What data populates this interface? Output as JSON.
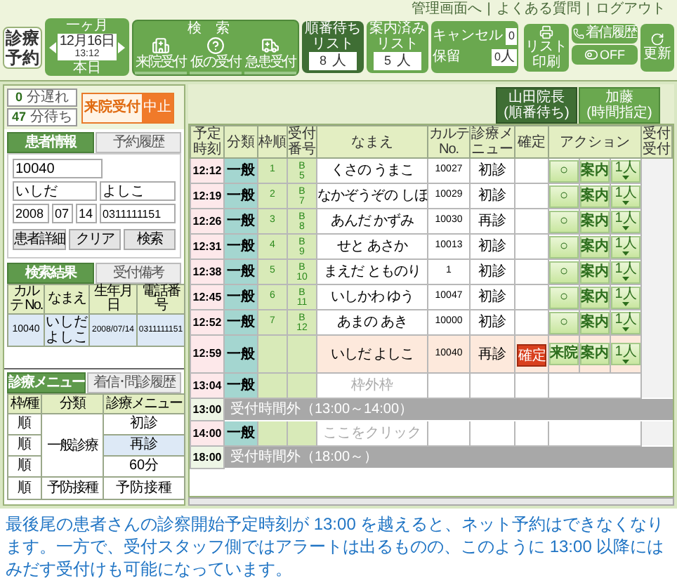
{
  "header": {
    "logo": [
      "診療",
      "予約"
    ],
    "date": {
      "range": "一ヶ月",
      "date": "12月16日",
      "time": "13:12",
      "today": "本日"
    },
    "search_label": "検索",
    "actions": [
      {
        "label": "来院受付"
      },
      {
        "label": "仮の受付"
      },
      {
        "label": "急患受付"
      }
    ],
    "lists": [
      {
        "label": "順番待ちリスト",
        "count": "8",
        "unit": "人",
        "selected": true
      },
      {
        "label": "案内済みリスト",
        "count": "5",
        "unit": "人",
        "selected": false
      }
    ],
    "cancel": {
      "label": "キャンセル",
      "count": "0"
    },
    "hold": {
      "label": "保留",
      "count": "0",
      "unit": "人"
    },
    "links": [
      "管理画面へ",
      "よくある質問",
      "ログアウト"
    ],
    "link_separator": "|",
    "tools": {
      "print": "リスト印刷",
      "history": "着信履歴",
      "off": "OFF",
      "refresh": "更新"
    }
  },
  "status": {
    "late": "0",
    "late_unit": "分遅れ",
    "wait": "47",
    "wait_unit": "分待ち",
    "mode": "来院受付",
    "stop": "中止"
  },
  "patient_tabs": [
    {
      "label": "患者情報",
      "selected": true
    },
    {
      "label": "予約履歴",
      "selected": false
    }
  ],
  "patient_form": {
    "id": "10040",
    "last_name": "いしだ",
    "first_name": "よしこ",
    "year": "2008",
    "month": "07",
    "day": "14",
    "phone": "0311111151"
  },
  "form_buttons": [
    "患者詳細",
    "クリア",
    "検索"
  ],
  "result_tabs": [
    {
      "label": "検索結果",
      "selected": true
    },
    {
      "label": "受付備考",
      "selected": false
    }
  ],
  "result_columns": [
    "カルテ No.",
    "なまえ",
    "生年月日",
    "電話番号"
  ],
  "result_rows": [
    {
      "chart": "10040",
      "last_name": "いしだ",
      "first_name": "よしこ",
      "birth": "2008/07/14",
      "phone": "0311111151"
    }
  ],
  "menu_tabs": [
    {
      "label": "診療メニュー",
      "selected": true
    },
    {
      "label": "着信･問診履歴",
      "selected": false
    }
  ],
  "menu_columns": [
    "枠/種",
    "分類",
    "診療メニュー"
  ],
  "menu_group": "一般診療",
  "menu_rows": [
    {
      "slot": "順",
      "item": "初診",
      "selected": false
    },
    {
      "slot": "順",
      "item": "再診",
      "selected": true
    },
    {
      "slot": "順",
      "item": "60分",
      "selected": false
    },
    {
      "slot": "順",
      "category": "予防接種",
      "item": "予防接種",
      "selected": false
    }
  ],
  "doctor_tabs": [
    {
      "name": "山田院長",
      "mode": "(順番待ち)",
      "selected": true
    },
    {
      "name": "加藤",
      "mode": "(時間指定)",
      "selected": false
    }
  ],
  "columns": [
    "予定時刻",
    "分類",
    "枠順",
    "受付番号",
    "なまえ",
    "カルテ No.",
    "診療メニュー",
    "確定",
    "アクション",
    "受付受付"
  ],
  "rows": [
    {
      "kind": "slot",
      "time": "12:12",
      "category": "一般",
      "order": "1",
      "number": [
        "B",
        "5"
      ],
      "name": "くさの うまこ",
      "chart": "10027",
      "menu": "初診",
      "selected": false,
      "actions": [
        {
          "kind": "mark",
          "label": "○"
        },
        {
          "kind": "guide",
          "label": "案内"
        },
        {
          "kind": "count",
          "label": "1人"
        }
      ]
    },
    {
      "kind": "slot",
      "time": "12:19",
      "category": "一般",
      "order": "2",
      "number": [
        "B",
        "7"
      ],
      "name": "なかぞうぞの しほ",
      "chart": "10029",
      "menu": "初診",
      "selected": false,
      "actions": [
        {
          "kind": "mark",
          "label": "○"
        },
        {
          "kind": "guide",
          "label": "案内"
        },
        {
          "kind": "count",
          "label": "1人"
        }
      ]
    },
    {
      "kind": "slot",
      "time": "12:26",
      "category": "一般",
      "order": "3",
      "number": [
        "B",
        "8"
      ],
      "name": "あんだ かずみ",
      "chart": "10030",
      "menu": "再診",
      "selected": false,
      "actions": [
        {
          "kind": "mark",
          "label": "○"
        },
        {
          "kind": "guide",
          "label": "案内"
        },
        {
          "kind": "count",
          "label": "1人"
        }
      ]
    },
    {
      "kind": "slot",
      "time": "12:31",
      "category": "一般",
      "order": "4",
      "number": [
        "B",
        "9"
      ],
      "name": "せと あさか",
      "chart": "10013",
      "menu": "初診",
      "selected": false,
      "actions": [
        {
          "kind": "mark",
          "label": "○"
        },
        {
          "kind": "guide",
          "label": "案内"
        },
        {
          "kind": "count",
          "label": "1人"
        }
      ]
    },
    {
      "kind": "slot",
      "time": "12:38",
      "category": "一般",
      "order": "5",
      "number": [
        "B",
        "10"
      ],
      "name": "まえだ とものり",
      "chart": "1",
      "menu": "初診",
      "selected": false,
      "actions": [
        {
          "kind": "mark",
          "label": "○"
        },
        {
          "kind": "guide",
          "label": "案内"
        },
        {
          "kind": "count",
          "label": "1人"
        }
      ]
    },
    {
      "kind": "slot",
      "time": "12:45",
      "category": "一般",
      "order": "6",
      "number": [
        "B",
        "11"
      ],
      "name": "いしかわ ゆう",
      "chart": "10047",
      "menu": "初診",
      "selected": false,
      "actions": [
        {
          "kind": "mark",
          "label": "○"
        },
        {
          "kind": "guide",
          "label": "案内"
        },
        {
          "kind": "count",
          "label": "1人"
        }
      ]
    },
    {
      "kind": "slot",
      "time": "12:52",
      "category": "一般",
      "order": "7",
      "number": [
        "B",
        "12"
      ],
      "name": "あまの あき",
      "chart": "10000",
      "menu": "初診",
      "selected": false,
      "actions": [
        {
          "kind": "mark",
          "label": "○"
        },
        {
          "kind": "guide",
          "label": "案内"
        },
        {
          "kind": "count",
          "label": "1人"
        }
      ]
    },
    {
      "kind": "slot",
      "time": "12:59",
      "category": "一般",
      "name": "いしだ よしこ",
      "chart": "10040",
      "menu": "再診",
      "confirm": "確定",
      "selected": true,
      "actions": [
        {
          "kind": "arrive",
          "label": "来院"
        },
        {
          "kind": "guide",
          "label": "案内"
        },
        {
          "kind": "count",
          "label": "1人"
        }
      ]
    },
    {
      "kind": "slot",
      "time": "13:04",
      "category": "一般",
      "hint": "枠外枠",
      "selected": false
    },
    {
      "kind": "band",
      "time": "13:00",
      "text": "受付時間外（13:00～14:00）"
    },
    {
      "kind": "slot",
      "time": "14:00",
      "category": "一般",
      "hint": "ここをクリック",
      "selected": false
    },
    {
      "kind": "band",
      "time": "18:00",
      "text": "受付時間外（18:00～）"
    }
  ],
  "caption": "最後尾の患者さんの診察開始予定時刻が 13:00 を越えると、ネット予約はできなくなります。一方で、受付スタッフ側ではアラートは出るものの、このように 13:00 以降にはみだす受付けも可能になっています。"
}
